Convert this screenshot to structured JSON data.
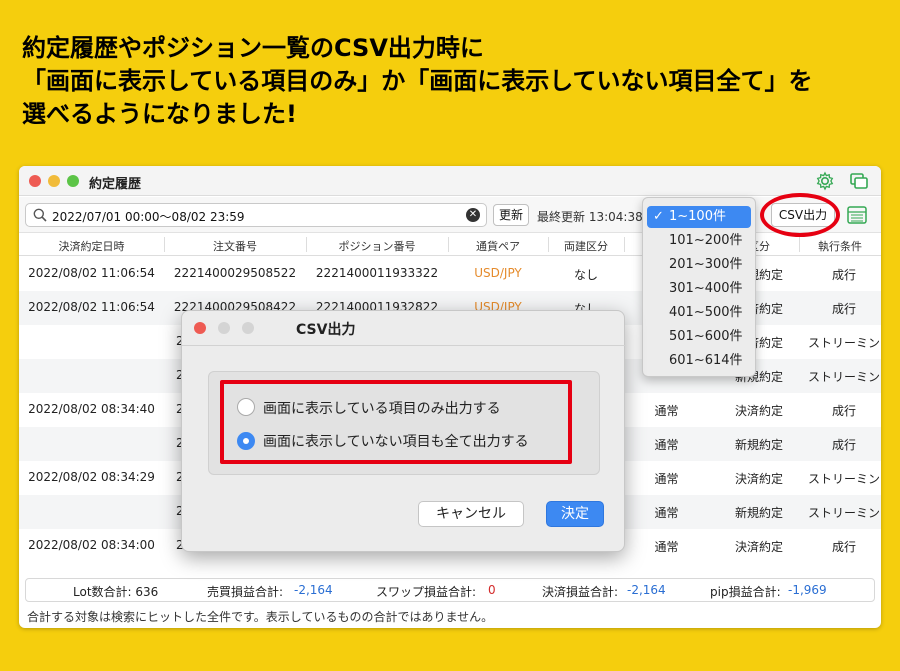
{
  "headline": {
    "line1": "約定履歴やポジション一覧のCSV出力時に",
    "line2": "「画面に表示している項目のみ」か「画面に表示していない項目全て」を",
    "line3": "選べるようになりました!"
  },
  "window": {
    "title": "約定履歴",
    "search_value": "2022/07/01 00:00〜08/02 23:59",
    "refresh_label": "更新",
    "last_updated": "最終更新 13:04:38",
    "csv_button_label": "CSV出力",
    "columns": [
      "決済約定日時",
      "注文番号",
      "ポジション番号",
      "通貨ペア",
      "両建区分",
      "",
      "区分",
      "執行条件"
    ],
    "rows": [
      {
        "dt": "2022/08/02 11:06:54",
        "order": "2221400029508522",
        "pos": "2221400011933322",
        "pair": "USD/JPY",
        "hedge": "なし",
        "type": "",
        "kubun": "新規約定",
        "cond": "成行"
      },
      {
        "dt": "2022/08/02 11:06:54",
        "order": "2221400029508422",
        "pos": "2221400011932822",
        "pair": "USD/JPY",
        "hedge": "なし",
        "type": "",
        "kubun": "決済約定",
        "cond": "成行"
      },
      {
        "dt": "",
        "order": "2",
        "pos": "",
        "pair": "",
        "hedge": "",
        "type": "",
        "kubun": "決済約定",
        "cond": "ストリーミン"
      },
      {
        "dt": "",
        "order": "2",
        "pos": "",
        "pair": "",
        "hedge": "",
        "type": "",
        "kubun": "新規約定",
        "cond": "ストリーミン"
      },
      {
        "dt": "2022/08/02 08:34:40",
        "order": "2",
        "pos": "",
        "pair": "",
        "hedge": "",
        "type": "通常",
        "kubun": "決済約定",
        "cond": "成行"
      },
      {
        "dt": "",
        "order": "2",
        "pos": "",
        "pair": "",
        "hedge": "",
        "type": "通常",
        "kubun": "新規約定",
        "cond": "成行"
      },
      {
        "dt": "2022/08/02 08:34:29",
        "order": "2",
        "pos": "",
        "pair": "",
        "hedge": "",
        "type": "通常",
        "kubun": "決済約定",
        "cond": "ストリーミン"
      },
      {
        "dt": "",
        "order": "2",
        "pos": "",
        "pair": "",
        "hedge": "",
        "type": "通常",
        "kubun": "新規約定",
        "cond": "ストリーミン"
      },
      {
        "dt": "2022/08/02 08:34:00",
        "order": "2",
        "pos": "",
        "pair": "",
        "hedge": "",
        "type": "通常",
        "kubun": "決済約定",
        "cond": "成行"
      }
    ],
    "footer": {
      "lot_label": "Lot数合計: 636",
      "trade_label": "売買損益合計:",
      "trade_value": "-2,164",
      "swap_label": "スワップ損益合計:",
      "swap_value": "0",
      "settle_label": "決済損益合計:",
      "settle_value": "-2,164",
      "pip_label": "pip損益合計:",
      "pip_value": "-1,969"
    },
    "note": "合計する対象は検索にヒットした全件です。表示しているものの合計ではありません。"
  },
  "dropdown": {
    "options": [
      "1~100件",
      "101~200件",
      "201~300件",
      "301~400件",
      "401~500件",
      "501~600件",
      "601~614件"
    ],
    "selected_index": 0
  },
  "dialog": {
    "title": "CSV出力",
    "option1": "画面に表示している項目のみ出力する",
    "option2": "画面に表示していない項目も全て出力する",
    "selected": 2,
    "cancel_label": "キャンセル",
    "ok_label": "決定"
  },
  "colors": {
    "background": "#f5ce0d",
    "accent_blue": "#3d89f2",
    "highlight_red": "#e60012",
    "pair_orange": "#e58b2c"
  }
}
